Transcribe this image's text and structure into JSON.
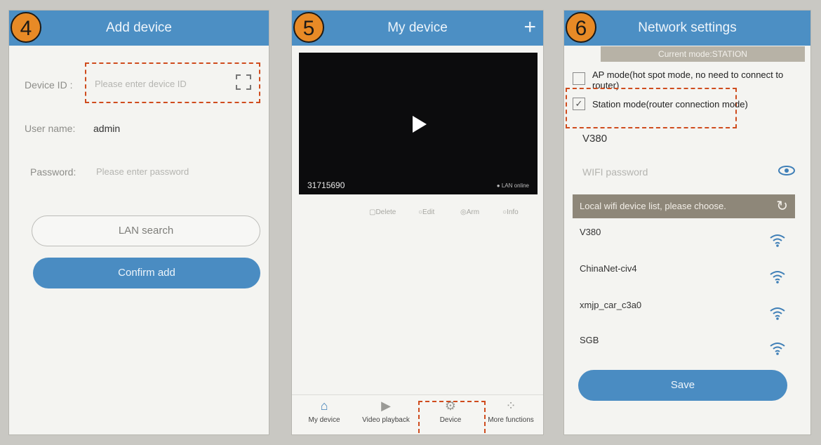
{
  "panel4": {
    "step": "4",
    "title": "Add device",
    "device_id_label": "Device ID :",
    "device_id_placeholder": "Please enter device ID",
    "user_name_label": "User name:",
    "user_name_value": "admin",
    "password_label": "Password:",
    "password_placeholder": "Please enter password",
    "lan_search": "LAN search",
    "confirm_add": "Confirm add"
  },
  "panel5": {
    "step": "5",
    "title": "My device",
    "plus_icon": "plus-icon",
    "device_id": "31715690",
    "lan_status": "LAN online",
    "actions": [
      "Delete",
      "Edit",
      "Arm",
      "Info"
    ],
    "tabs": [
      {
        "label": "My device",
        "icon": "home-icon"
      },
      {
        "label": "Video playback",
        "icon": "play-icon"
      },
      {
        "label": "Device",
        "icon": "gear-icon"
      },
      {
        "label": "More functions",
        "icon": "grid-icon"
      }
    ]
  },
  "panel6": {
    "step": "6",
    "title": "Network settings",
    "current_mode": "Current mode:STATION",
    "ap_mode": "AP mode(hot spot mode, no need to connect to router)",
    "station_mode": "Station mode(router connection mode)",
    "ssid": "V380",
    "wifi_password_placeholder": "WIFI password",
    "list_header": "Local wifi device list, please choose.",
    "networks": [
      {
        "name": "V380"
      },
      {
        "name": "ChinaNet-civ4"
      },
      {
        "name": "xmjp_car_c3a0"
      },
      {
        "name": "SGB"
      }
    ],
    "save": "Save"
  },
  "colors": {
    "appbar": "#4c8fc4",
    "step_badge": "#e88a26",
    "highlight_dash": "#cf4c1e",
    "button_primary": "#4a8cc2"
  }
}
